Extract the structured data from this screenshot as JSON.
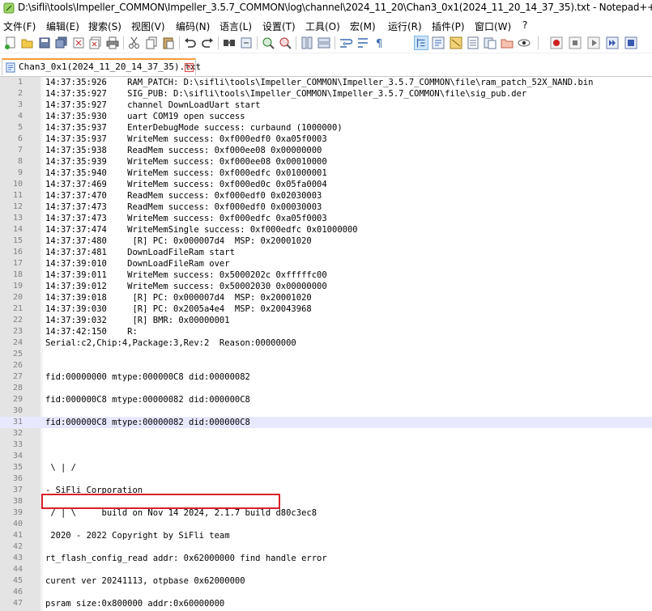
{
  "window": {
    "title": "D:\\sifli\\tools\\Impeller_COMMON\\Impeller_3.5.7_COMMON\\log\\channel\\2024_11_20\\Chan3_0x1(2024_11_20_14_37_35).txt - Notepad++"
  },
  "menu": {
    "items": [
      "文件(F)",
      "编辑(E)",
      "搜索(S)",
      "视图(V)",
      "编码(N)",
      "语言(L)",
      "设置(T)",
      "工具(O)",
      "宏(M)",
      "运行(R)",
      "插件(P)",
      "窗口(W)",
      "?"
    ]
  },
  "tab": {
    "label": "Chan3_0x1(2024_11_20_14_37_35).txt",
    "close_glyph": "✕"
  },
  "editor": {
    "current_line": 31,
    "lines": [
      {
        "n": "1",
        "text": "14:37:35:926    RAM_PATCH: D:\\sifli\\tools\\Impeller_COMMON\\Impeller_3.5.7_COMMON\\file\\ram_patch_52X_NAND.bin"
      },
      {
        "n": "2",
        "text": "14:37:35:927    SIG_PUB: D:\\sifli\\tools\\Impeller_COMMON\\Impeller_3.5.7_COMMON\\file\\sig_pub.der"
      },
      {
        "n": "3",
        "text": "14:37:35:927    channel DownLoadUart start"
      },
      {
        "n": "4",
        "text": "14:37:35:930    uart COM19 open success"
      },
      {
        "n": "5",
        "text": "14:37:35:937    EnterDebugMode success: curbaund (1000000)"
      },
      {
        "n": "6",
        "text": "14:37:35:937    WriteMem success: 0xf000edf0 0xa05f0003"
      },
      {
        "n": "7",
        "text": "14:37:35:938    ReadMem success: 0xf000ee08 0x00000000"
      },
      {
        "n": "8",
        "text": "14:37:35:939    WriteMem success: 0xf000ee08 0x00010000"
      },
      {
        "n": "9",
        "text": "14:37:35:940    WriteMem success: 0xf000edfc 0x01000001"
      },
      {
        "n": "10",
        "text": "14:37:37:469    WriteMem success: 0xf000ed0c 0x05fa0004"
      },
      {
        "n": "11",
        "text": "14:37:37:470    ReadMem success: 0xf000edf0 0x02030003"
      },
      {
        "n": "12",
        "text": "14:37:37:473    ReadMem success: 0xf000edf0 0x00030003"
      },
      {
        "n": "13",
        "text": "14:37:37:473    WriteMem success: 0xf000edfc 0xa05f0003"
      },
      {
        "n": "14",
        "text": "14:37:37:474    WriteMemSingle success: 0xf000edfc 0x01000000"
      },
      {
        "n": "15",
        "text": "14:37:37:480     [R] PC: 0x000007d4  MSP: 0x20001020"
      },
      {
        "n": "16",
        "text": "14:37:37:481    DownLoadFileRam start"
      },
      {
        "n": "17",
        "text": "14:37:39:010    DownLoadFileRam over"
      },
      {
        "n": "18",
        "text": "14:37:39:011    WriteMem success: 0x5000202c 0xfffffc00"
      },
      {
        "n": "19",
        "text": "14:37:39:012    WriteMem success: 0x50002030 0x00000000"
      },
      {
        "n": "20",
        "text": "14:37:39:018     [R] PC: 0x000007d4  MSP: 0x20001020"
      },
      {
        "n": "21",
        "text": "14:37:39:030     [R] PC: 0x2005a4e4  MSP: 0x20043968"
      },
      {
        "n": "22",
        "text": "14:37:39:032     [R] BMR: 0x00000001"
      },
      {
        "n": "23",
        "text": "14:37:42:150    R:"
      },
      {
        "n": "24",
        "text": "Serial:c2,Chip:4,Package:3,Rev:2  Reason:00000000"
      },
      {
        "n": "25",
        "text": ""
      },
      {
        "n": "26",
        "text": ""
      },
      {
        "n": "27",
        "text": "fid:00000000 mtype:000000C8 did:00000082"
      },
      {
        "n": "28",
        "text": ""
      },
      {
        "n": "29",
        "text": "fid:000000C8 mtype:00000082 did:000000C8"
      },
      {
        "n": "30",
        "text": ""
      },
      {
        "n": "31",
        "text": "fid:000000C8 mtype:00000082 did:000000C8"
      },
      {
        "n": "32",
        "text": ""
      },
      {
        "n": "33",
        "text": ""
      },
      {
        "n": "34",
        "text": ""
      },
      {
        "n": "35",
        "text": " \\ | /"
      },
      {
        "n": "36",
        "text": ""
      },
      {
        "n": "37",
        "text": "- SiFli Corporation"
      },
      {
        "n": "38",
        "text": ""
      },
      {
        "n": "39",
        "text": " / | \\     build on Nov 14 2024, 2.1.7 build d80c3ec8"
      },
      {
        "n": "40",
        "text": ""
      },
      {
        "n": "41",
        "text": " 2020 - 2022 Copyright by SiFli team"
      },
      {
        "n": "42",
        "text": ""
      },
      {
        "n": "43",
        "text": "rt_flash_config_read addr: 0x62000000 find handle error"
      },
      {
        "n": "44",
        "text": ""
      },
      {
        "n": "45",
        "text": "curent ver 20241113, otpbase 0x62000000"
      },
      {
        "n": "46",
        "text": ""
      },
      {
        "n": "47",
        "text": "psram size:0x800000 addr:0x60000000"
      }
    ]
  }
}
